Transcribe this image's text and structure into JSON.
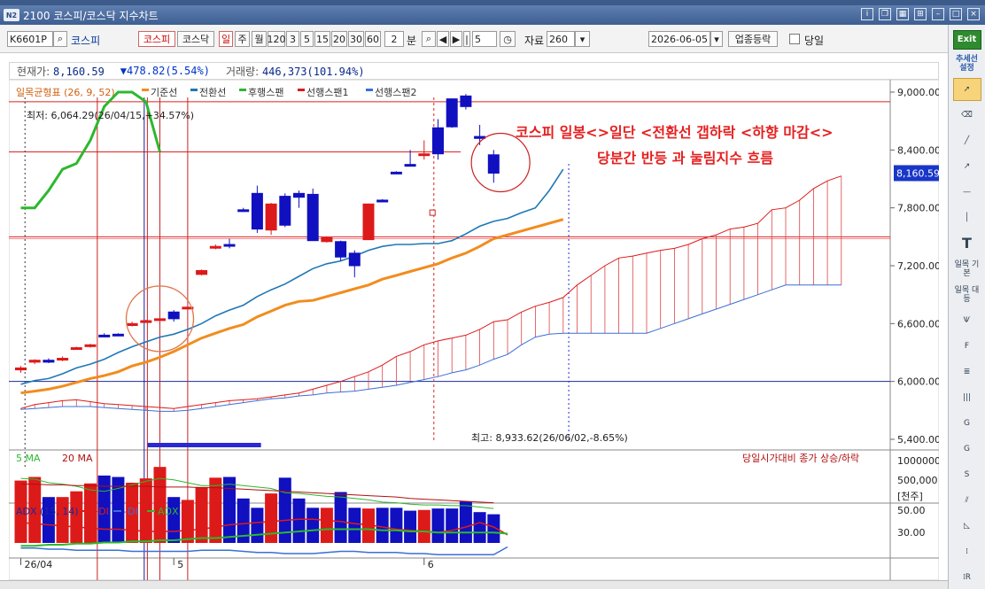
{
  "window": {
    "title": "2100 코스피/코스닥 지수차트",
    "badge": "N2"
  },
  "toolbar": {
    "code": "K6601P",
    "code_name": "코스피",
    "market_buttons": [
      "코스피",
      "코스닥"
    ],
    "period_buttons": [
      "일",
      "주",
      "월",
      "120",
      "3",
      "5",
      "15",
      "20",
      "30",
      "60"
    ],
    "minute_value": "2",
    "minute_label": "분",
    "step_value": "5",
    "data_label": "자료",
    "data_count": "260",
    "date": "2026-06-05",
    "sector_button": "업종등락",
    "today_label": "당일"
  },
  "sidebar": {
    "exit": "Exit",
    "trendline_settings": "추세선 설정",
    "ichimoku_basic": "일목 기본",
    "ichimoku_equal": "일목 대등",
    "text_tool": "T"
  },
  "info_bar": {
    "price_label": "현재가:",
    "price": "8,160.59",
    "change": "▼478.82(5.54%)",
    "volume_label": "거래량:",
    "volume": "446,373(101.94%)"
  },
  "legend": {
    "title": "일목균형표 (26, 9, 52)",
    "items": [
      {
        "name": "기준선",
        "color": "#f28c1e"
      },
      {
        "name": "전환선",
        "color": "#1f78b4"
      },
      {
        "name": "후행스팬",
        "color": "#2db82d"
      },
      {
        "name": "선행스팬1",
        "color": "#dd1a1a"
      },
      {
        "name": "선행스팬2",
        "color": "#3a6fd8"
      }
    ]
  },
  "annotations": {
    "low_label": "최저: 6,064.29(26/04/15,+34.57%)",
    "high_label": "최고: 8,933.62(26/06/02,-8.65%)",
    "comment_line1": "코스피 일봉<>일단 <전환선  갭하락 <하향 마감<>",
    "comment_line2": "당분간 반등 과 눌림지수 흐름",
    "current_price_tag": "8,160.59",
    "volume_note": "당일시가대비 종가 상승/하락",
    "volume_unit": "[천주]"
  },
  "colors": {
    "up": "#dd1a1a",
    "down": "#1010c0",
    "kijun": "#f28c1e",
    "tenkan": "#1f78b4",
    "chikou": "#2db82d",
    "span1": "#dd1a1a",
    "span2": "#3a6fd8",
    "plus_di": "#dd1a1a",
    "minus_di": "#3a6fd8",
    "adx": "#2db82d"
  },
  "chart_data": [
    {
      "type": "candlestick",
      "title": "일목균형표 (26, 9, 52)",
      "ylim": [
        5200,
        9200
      ],
      "y_ticks": [
        "9,000.00",
        "8,400.00",
        "7,800.00",
        "7,200.00",
        "6,600.00",
        "6,000.00",
        "5,400.00"
      ],
      "y_tick_values": [
        9000,
        8400,
        7800,
        7200,
        6600,
        6000,
        5400
      ],
      "x_labels": [
        {
          "label": "26/04",
          "bar": 0
        },
        {
          "label": "5",
          "bar": 11
        },
        {
          "label": "6",
          "bar": 29
        }
      ],
      "candles": [
        {
          "o": 6120,
          "h": 6160,
          "l": 6090,
          "c": 6140
        },
        {
          "o": 6200,
          "h": 6230,
          "l": 6180,
          "c": 6220
        },
        {
          "o": 6220,
          "h": 6240,
          "l": 6190,
          "c": 6200
        },
        {
          "o": 6230,
          "h": 6260,
          "l": 6210,
          "c": 6240
        },
        {
          "o": 6340,
          "h": 6360,
          "l": 6330,
          "c": 6350
        },
        {
          "o": 6370,
          "h": 6390,
          "l": 6350,
          "c": 6380
        },
        {
          "o": 6480,
          "h": 6500,
          "l": 6470,
          "c": 6470
        },
        {
          "o": 6490,
          "h": 6500,
          "l": 6470,
          "c": 6480
        },
        {
          "o": 6580,
          "h": 6620,
          "l": 6570,
          "c": 6600
        },
        {
          "o": 6620,
          "h": 6640,
          "l": 6610,
          "c": 6630
        },
        {
          "o": 6640,
          "h": 6660,
          "l": 6620,
          "c": 6650
        },
        {
          "o": 6720,
          "h": 6740,
          "l": 6620,
          "c": 6650
        },
        {
          "o": 6770,
          "h": 6780,
          "l": 6750,
          "c": 6770
        },
        {
          "o": 7110,
          "h": 7160,
          "l": 7100,
          "c": 7150
        },
        {
          "o": 7390,
          "h": 7420,
          "l": 7370,
          "c": 7400
        },
        {
          "o": 7420,
          "h": 7480,
          "l": 7380,
          "c": 7410
        },
        {
          "o": 7780,
          "h": 7800,
          "l": 7760,
          "c": 7770
        },
        {
          "o": 7950,
          "h": 8030,
          "l": 7540,
          "c": 7580
        },
        {
          "o": 7570,
          "h": 7850,
          "l": 7520,
          "c": 7840
        },
        {
          "o": 7920,
          "h": 7950,
          "l": 7600,
          "c": 7620
        },
        {
          "o": 7950,
          "h": 7980,
          "l": 7800,
          "c": 7910
        },
        {
          "o": 7940,
          "h": 8000,
          "l": 7500,
          "c": 7460
        },
        {
          "o": 7450,
          "h": 7500,
          "l": 7440,
          "c": 7490
        },
        {
          "o": 7450,
          "h": 7460,
          "l": 7250,
          "c": 7290
        },
        {
          "o": 7330,
          "h": 7360,
          "l": 7080,
          "c": 7200
        },
        {
          "o": 7470,
          "h": 7840,
          "l": 7470,
          "c": 7840
        },
        {
          "o": 7880,
          "h": 7890,
          "l": 7860,
          "c": 7870
        },
        {
          "o": 8170,
          "h": 8180,
          "l": 8150,
          "c": 8160
        },
        {
          "o": 8250,
          "h": 8400,
          "l": 8230,
          "c": 8240
        },
        {
          "o": 8350,
          "h": 8500,
          "l": 8300,
          "c": 8360
        },
        {
          "o": 8630,
          "h": 8720,
          "l": 8300,
          "c": 8360
        },
        {
          "o": 8930,
          "h": 8934,
          "l": 8630,
          "c": 8640
        },
        {
          "o": 8960,
          "h": 8980,
          "l": 8820,
          "c": 8850
        },
        {
          "o": 8540,
          "h": 8660,
          "l": 8450,
          "c": 8520
        },
        {
          "o": 8350,
          "h": 8400,
          "l": 8060,
          "c": 8160
        }
      ],
      "kijun": [
        5880,
        5900,
        5920,
        5950,
        5990,
        6030,
        6060,
        6100,
        6160,
        6200,
        6250,
        6310,
        6380,
        6450,
        6500,
        6550,
        6590,
        6670,
        6730,
        6790,
        6830,
        6840,
        6880,
        6920,
        6960,
        7000,
        7060,
        7100,
        7140,
        7180,
        7220,
        7280,
        7330,
        7400,
        7480,
        7520,
        7560,
        7600,
        7640,
        7680
      ],
      "tenkan": [
        5970,
        6010,
        6030,
        6080,
        6140,
        6180,
        6230,
        6300,
        6360,
        6410,
        6460,
        6490,
        6540,
        6600,
        6680,
        6740,
        6790,
        6880,
        6950,
        7010,
        7090,
        7170,
        7220,
        7250,
        7300,
        7360,
        7400,
        7420,
        7420,
        7430,
        7430,
        7460,
        7530,
        7610,
        7660,
        7690,
        7750,
        7800,
        7980,
        8200
      ],
      "chikou": [
        7800,
        7800,
        7980,
        8200,
        8260,
        8500,
        8850,
        9000,
        9000,
        8900,
        8380
      ],
      "span1": [
        5720,
        5760,
        5780,
        5800,
        5810,
        5790,
        5770,
        5760,
        5750,
        5740,
        5730,
        5720,
        5740,
        5760,
        5780,
        5800,
        5810,
        5820,
        5840,
        5860,
        5880,
        5920,
        5960,
        6000,
        6050,
        6100,
        6170,
        6260,
        6310,
        6380,
        6420,
        6450,
        6480,
        6540,
        6620,
        6640,
        6720,
        6780,
        6820,
        6870,
        7000,
        7100,
        7200,
        7280,
        7300,
        7330,
        7360,
        7380,
        7420,
        7480,
        7520,
        7580,
        7600,
        7640,
        7780,
        7800,
        7880,
        8000,
        8080,
        8130
      ],
      "span2": [
        5710,
        5720,
        5730,
        5740,
        5740,
        5740,
        5730,
        5720,
        5710,
        5700,
        5690,
        5690,
        5700,
        5720,
        5740,
        5760,
        5780,
        5800,
        5820,
        5830,
        5850,
        5860,
        5880,
        5890,
        5900,
        5920,
        5940,
        5960,
        5990,
        6020,
        6050,
        6090,
        6120,
        6170,
        6230,
        6280,
        6380,
        6460,
        6490,
        6500,
        6500,
        6500,
        6500,
        6500,
        6500,
        6500,
        6550,
        6600,
        6650,
        6700,
        6750,
        6800,
        6850,
        6900,
        6950,
        7000,
        7000,
        7000,
        7000,
        7000
      ]
    },
    {
      "type": "bar",
      "title": "당일시가대비 종가 상승/하락",
      "series_labels": [
        "5 MA",
        "20 MA"
      ],
      "y_ticks": [
        "1000000",
        "500,000"
      ],
      "y_tick_values": [
        1000000,
        500000
      ],
      "ylim": [
        0,
        1150000
      ],
      "volumes": [
        870000,
        920000,
        640000,
        640000,
        720000,
        830000,
        940000,
        920000,
        840000,
        900000,
        1060000,
        640000,
        600000,
        780000,
        910000,
        920000,
        620000,
        490000,
        690000,
        910000,
        620000,
        490000,
        490000,
        710000,
        490000,
        480000,
        490000,
        490000,
        450000,
        460000,
        480000,
        480000,
        580000,
        430000,
        400000
      ],
      "ma5": [
        900000,
        890000,
        840000,
        820000,
        790000,
        740000,
        720000,
        760000,
        810000,
        860000,
        900000,
        880000,
        840000,
        800000,
        800000,
        820000,
        800000,
        780000,
        760000,
        700000,
        690000,
        670000,
        650000,
        640000,
        620000,
        600000,
        570000,
        560000,
        540000,
        530000,
        530000,
        520000,
        520000,
        500000,
        480000
      ],
      "ma20": [
        820000,
        820000,
        810000,
        810000,
        800000,
        800000,
        790000,
        790000,
        790000,
        790000,
        780000,
        780000,
        780000,
        770000,
        770000,
        760000,
        750000,
        740000,
        730000,
        720000,
        710000,
        700000,
        690000,
        680000,
        670000,
        660000,
        650000,
        640000,
        620000,
        610000,
        600000,
        590000,
        580000,
        570000,
        560000
      ]
    },
    {
      "type": "line",
      "title": "ADX (15, 14)",
      "series_labels": [
        "+DI",
        "-DI",
        "ADX"
      ],
      "y_ticks": [
        "50.00",
        "30.00"
      ],
      "y_tick_values": [
        50,
        30
      ],
      "ylim": [
        0,
        60
      ],
      "plus_di": [
        42,
        41,
        40,
        39,
        38,
        37,
        36,
        36,
        35,
        34,
        34,
        34,
        35,
        36,
        38,
        40,
        41,
        42,
        43,
        44,
        45,
        45,
        44,
        43,
        41,
        40,
        38,
        36,
        35,
        34,
        33,
        35,
        38,
        42,
        38,
        31
      ],
      "minus_di": [
        19,
        19,
        18,
        18,
        17,
        17,
        17,
        17,
        16,
        16,
        16,
        16,
        16,
        17,
        17,
        17,
        16,
        15,
        15,
        14,
        14,
        14,
        15,
        16,
        16,
        15,
        15,
        15,
        14,
        14,
        13,
        13,
        13,
        13,
        13,
        20
      ],
      "adx": [
        21,
        21,
        22,
        22,
        23,
        23,
        24,
        24,
        25,
        25,
        26,
        26,
        27,
        28,
        28,
        29,
        30,
        31,
        32,
        33,
        34,
        35,
        36,
        36,
        36,
        36,
        35,
        35,
        34,
        34,
        33,
        33,
        33,
        33,
        33,
        32
      ]
    }
  ]
}
